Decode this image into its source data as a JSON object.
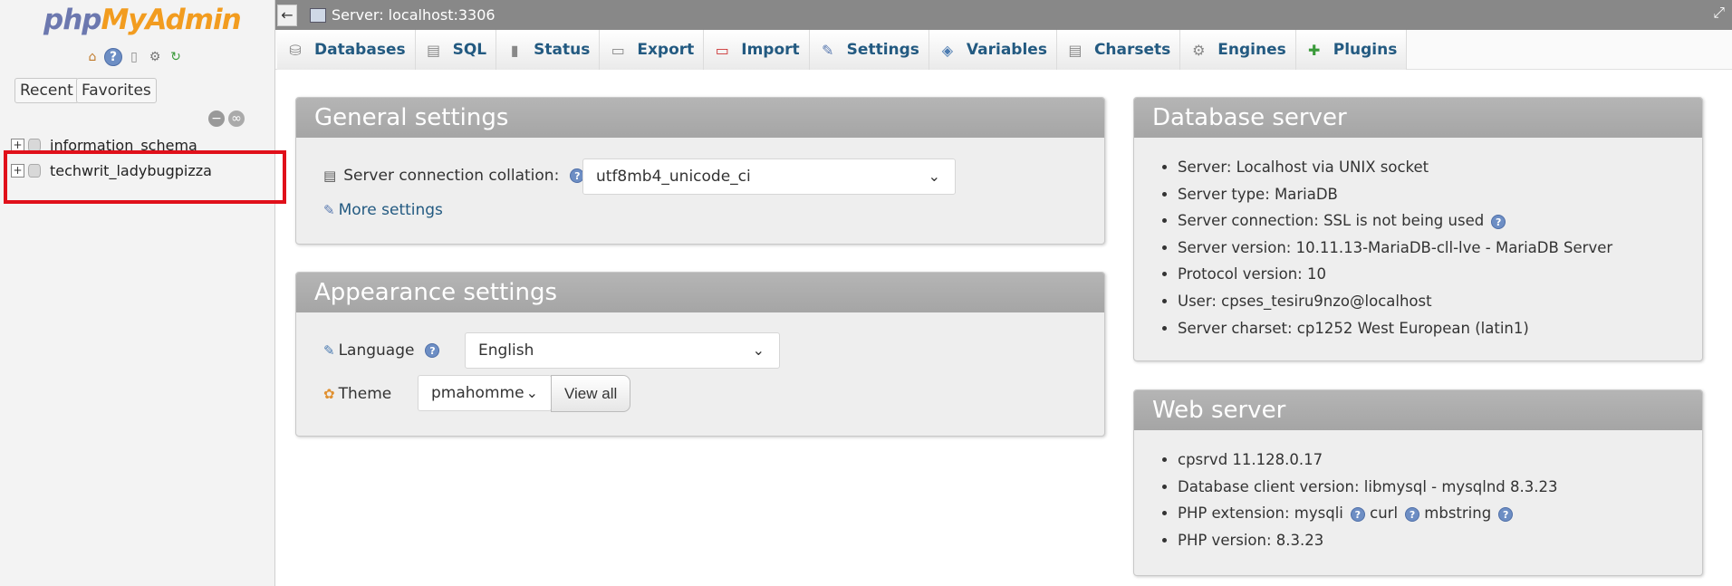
{
  "sidebar": {
    "logo_php": "php",
    "logo_myadmin": "MyAdmin",
    "nav_icons": [
      "home-icon",
      "help-icon",
      "docs-icon",
      "settings-icon",
      "reload-icon"
    ],
    "recent_label": "Recent",
    "favorites_label": "Favorites",
    "databases": [
      {
        "name": "information_schema"
      },
      {
        "name": "techwrit_ladybugpizza"
      }
    ]
  },
  "topbar": {
    "breadcrumb": "Server: localhost:3306"
  },
  "tabs": [
    {
      "label": "Databases",
      "icon": "database-icon"
    },
    {
      "label": "SQL",
      "icon": "sql-icon"
    },
    {
      "label": "Status",
      "icon": "status-icon"
    },
    {
      "label": "Export",
      "icon": "export-icon"
    },
    {
      "label": "Import",
      "icon": "import-icon"
    },
    {
      "label": "Settings",
      "icon": "wrench-icon"
    },
    {
      "label": "Variables",
      "icon": "variables-icon"
    },
    {
      "label": "Charsets",
      "icon": "charsets-icon"
    },
    {
      "label": "Engines",
      "icon": "engines-icon"
    },
    {
      "label": "Plugins",
      "icon": "plugins-icon"
    }
  ],
  "general": {
    "title": "General settings",
    "collation_label": "Server connection collation:",
    "collation_value": "utf8mb4_unicode_ci",
    "more_settings": "More settings"
  },
  "appearance": {
    "title": "Appearance settings",
    "language_label": "Language",
    "language_value": "English",
    "theme_label": "Theme",
    "theme_value": "pmahomme",
    "view_all": "View all"
  },
  "db_server": {
    "title": "Database server",
    "items": [
      "Server: Localhost via UNIX socket",
      "Server type: MariaDB",
      "Server connection: SSL is not being used",
      "Server version: 10.11.13-MariaDB-cll-lve - MariaDB Server",
      "Protocol version: 10",
      "User: cpses_tesiru9nzo@localhost",
      "Server charset: cp1252 West European (latin1)"
    ]
  },
  "web_server": {
    "title": "Web server",
    "items": [
      "cpsrvd 11.128.0.17",
      "Database client version: libmysql - mysqlnd 8.3.23",
      "PHP version: 8.3.23"
    ],
    "php_ext_label": "PHP extension: mysqli",
    "php_ext_curl": "curl",
    "php_ext_mbstring": "mbstring"
  },
  "colors": {
    "highlight": "#e0101a",
    "tab_text": "#235a81",
    "panel_header": "#acacac",
    "topbar": "#888888"
  }
}
